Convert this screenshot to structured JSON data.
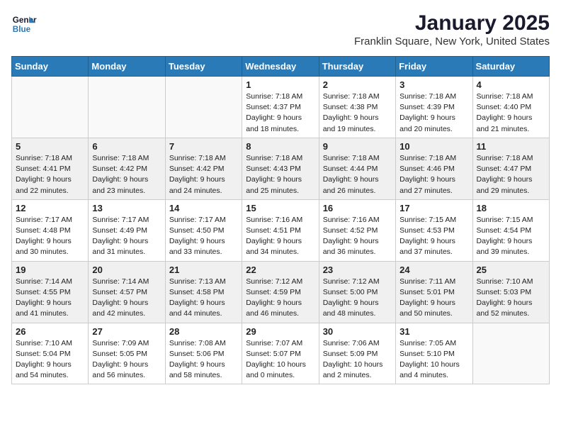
{
  "header": {
    "logo_line1": "General",
    "logo_line2": "Blue",
    "month_year": "January 2025",
    "location": "Franklin Square, New York, United States"
  },
  "weekdays": [
    "Sunday",
    "Monday",
    "Tuesday",
    "Wednesday",
    "Thursday",
    "Friday",
    "Saturday"
  ],
  "weeks": [
    [
      {
        "day": "",
        "empty": true
      },
      {
        "day": "",
        "empty": true
      },
      {
        "day": "",
        "empty": true
      },
      {
        "day": "1",
        "sunrise": "7:18 AM",
        "sunset": "4:37 PM",
        "daylight": "9 hours and 18 minutes."
      },
      {
        "day": "2",
        "sunrise": "7:18 AM",
        "sunset": "4:38 PM",
        "daylight": "9 hours and 19 minutes."
      },
      {
        "day": "3",
        "sunrise": "7:18 AM",
        "sunset": "4:39 PM",
        "daylight": "9 hours and 20 minutes."
      },
      {
        "day": "4",
        "sunrise": "7:18 AM",
        "sunset": "4:40 PM",
        "daylight": "9 hours and 21 minutes."
      }
    ],
    [
      {
        "day": "5",
        "sunrise": "7:18 AM",
        "sunset": "4:41 PM",
        "daylight": "9 hours and 22 minutes."
      },
      {
        "day": "6",
        "sunrise": "7:18 AM",
        "sunset": "4:42 PM",
        "daylight": "9 hours and 23 minutes."
      },
      {
        "day": "7",
        "sunrise": "7:18 AM",
        "sunset": "4:42 PM",
        "daylight": "9 hours and 24 minutes."
      },
      {
        "day": "8",
        "sunrise": "7:18 AM",
        "sunset": "4:43 PM",
        "daylight": "9 hours and 25 minutes."
      },
      {
        "day": "9",
        "sunrise": "7:18 AM",
        "sunset": "4:44 PM",
        "daylight": "9 hours and 26 minutes."
      },
      {
        "day": "10",
        "sunrise": "7:18 AM",
        "sunset": "4:46 PM",
        "daylight": "9 hours and 27 minutes."
      },
      {
        "day": "11",
        "sunrise": "7:18 AM",
        "sunset": "4:47 PM",
        "daylight": "9 hours and 29 minutes."
      }
    ],
    [
      {
        "day": "12",
        "sunrise": "7:17 AM",
        "sunset": "4:48 PM",
        "daylight": "9 hours and 30 minutes."
      },
      {
        "day": "13",
        "sunrise": "7:17 AM",
        "sunset": "4:49 PM",
        "daylight": "9 hours and 31 minutes."
      },
      {
        "day": "14",
        "sunrise": "7:17 AM",
        "sunset": "4:50 PM",
        "daylight": "9 hours and 33 minutes."
      },
      {
        "day": "15",
        "sunrise": "7:16 AM",
        "sunset": "4:51 PM",
        "daylight": "9 hours and 34 minutes."
      },
      {
        "day": "16",
        "sunrise": "7:16 AM",
        "sunset": "4:52 PM",
        "daylight": "9 hours and 36 minutes."
      },
      {
        "day": "17",
        "sunrise": "7:15 AM",
        "sunset": "4:53 PM",
        "daylight": "9 hours and 37 minutes."
      },
      {
        "day": "18",
        "sunrise": "7:15 AM",
        "sunset": "4:54 PM",
        "daylight": "9 hours and 39 minutes."
      }
    ],
    [
      {
        "day": "19",
        "sunrise": "7:14 AM",
        "sunset": "4:55 PM",
        "daylight": "9 hours and 41 minutes."
      },
      {
        "day": "20",
        "sunrise": "7:14 AM",
        "sunset": "4:57 PM",
        "daylight": "9 hours and 42 minutes."
      },
      {
        "day": "21",
        "sunrise": "7:13 AM",
        "sunset": "4:58 PM",
        "daylight": "9 hours and 44 minutes."
      },
      {
        "day": "22",
        "sunrise": "7:12 AM",
        "sunset": "4:59 PM",
        "daylight": "9 hours and 46 minutes."
      },
      {
        "day": "23",
        "sunrise": "7:12 AM",
        "sunset": "5:00 PM",
        "daylight": "9 hours and 48 minutes."
      },
      {
        "day": "24",
        "sunrise": "7:11 AM",
        "sunset": "5:01 PM",
        "daylight": "9 hours and 50 minutes."
      },
      {
        "day": "25",
        "sunrise": "7:10 AM",
        "sunset": "5:03 PM",
        "daylight": "9 hours and 52 minutes."
      }
    ],
    [
      {
        "day": "26",
        "sunrise": "7:10 AM",
        "sunset": "5:04 PM",
        "daylight": "9 hours and 54 minutes."
      },
      {
        "day": "27",
        "sunrise": "7:09 AM",
        "sunset": "5:05 PM",
        "daylight": "9 hours and 56 minutes."
      },
      {
        "day": "28",
        "sunrise": "7:08 AM",
        "sunset": "5:06 PM",
        "daylight": "9 hours and 58 minutes."
      },
      {
        "day": "29",
        "sunrise": "7:07 AM",
        "sunset": "5:07 PM",
        "daylight": "10 hours and 0 minutes."
      },
      {
        "day": "30",
        "sunrise": "7:06 AM",
        "sunset": "5:09 PM",
        "daylight": "10 hours and 2 minutes."
      },
      {
        "day": "31",
        "sunrise": "7:05 AM",
        "sunset": "5:10 PM",
        "daylight": "10 hours and 4 minutes."
      },
      {
        "day": "",
        "empty": true
      }
    ]
  ]
}
